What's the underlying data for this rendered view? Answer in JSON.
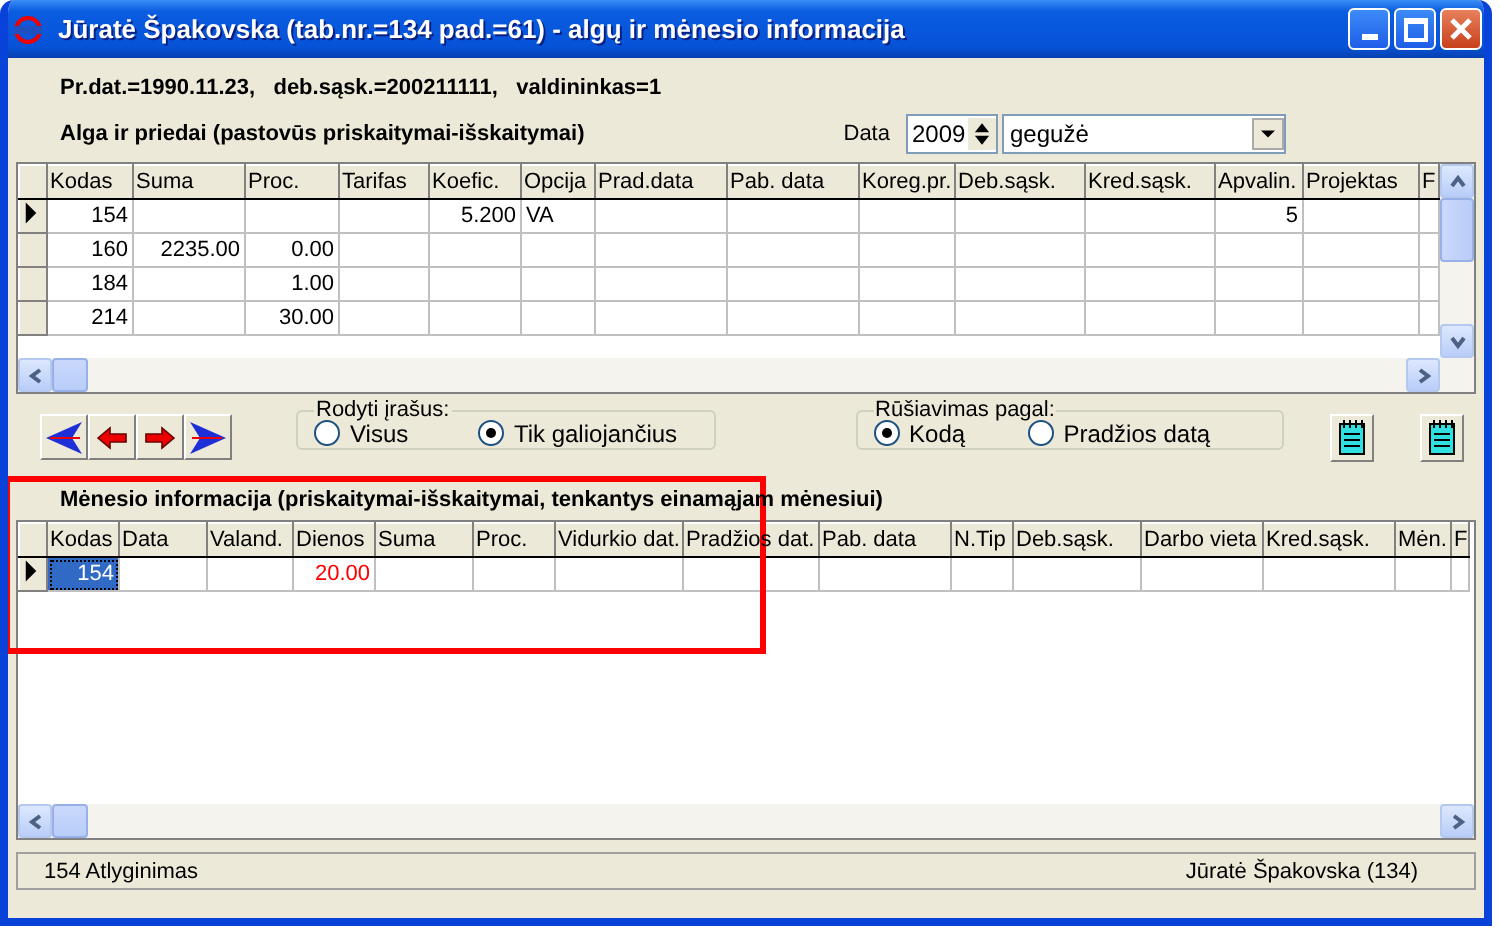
{
  "window": {
    "title": "Jūratė Špakovska (tab.nr.=134 pad.=61) - algų ir mėnesio informacija"
  },
  "info_line": "Pr.dat.=1990.11.23,   deb.sąsk.=200211111,   valdininkas=1",
  "salary_section": {
    "title": "Alga ir priedai (pastovūs priskaitymai-išskaitymai)",
    "date_label": "Data",
    "year": "2009",
    "month": "gegužė",
    "table": {
      "columns": [
        {
          "label": "Kodas",
          "kind": "number"
        },
        {
          "label": "Suma",
          "kind": "number"
        },
        {
          "label": "Proc.",
          "kind": "number"
        },
        {
          "label": "Tarifas",
          "kind": "number"
        },
        {
          "label": "Koefic.",
          "kind": "number"
        },
        {
          "label": "Opcija",
          "kind": "text"
        },
        {
          "label": "Prad.data",
          "kind": "text"
        },
        {
          "label": "Pab. data",
          "kind": "text"
        },
        {
          "label": "Koreg.pr.",
          "kind": "number"
        },
        {
          "label": "Deb.sąsk.",
          "kind": "text"
        },
        {
          "label": "Kred.sąsk.",
          "kind": "text"
        },
        {
          "label": "Apvalin.",
          "kind": "number"
        },
        {
          "label": "Projektas",
          "kind": "text"
        },
        {
          "label": "F",
          "kind": "text"
        }
      ],
      "rows": [
        {
          "selected": true,
          "cells": [
            "154",
            null,
            null,
            null,
            "5.200",
            "VA",
            null,
            null,
            null,
            null,
            null,
            "5",
            null,
            null
          ]
        },
        {
          "selected": false,
          "cells": [
            "160",
            "2235.00",
            "0.00",
            null,
            null,
            null,
            null,
            null,
            null,
            null,
            null,
            null,
            null,
            null
          ]
        },
        {
          "selected": false,
          "cells": [
            "184",
            null,
            "1.00",
            null,
            null,
            null,
            null,
            null,
            null,
            null,
            null,
            null,
            null,
            null
          ]
        },
        {
          "selected": false,
          "cells": [
            "214",
            null,
            "30.00",
            null,
            null,
            null,
            null,
            null,
            null,
            null,
            null,
            null,
            null,
            null
          ]
        }
      ]
    }
  },
  "show_records": {
    "title": "Rodyti įrašus:",
    "options": [
      {
        "label": "Visus",
        "selected": false
      },
      {
        "label": "Tik galiojančius",
        "selected": true
      }
    ]
  },
  "sort_by": {
    "title": "Rūšiavimas pagal:",
    "options": [
      {
        "label": "Kodą",
        "selected": true
      },
      {
        "label": "Pradžios datą",
        "selected": false
      }
    ]
  },
  "monthly_section": {
    "title": "Mėnesio informacija (priskaitymai-išskaitymai, tenkantys einamąjam mėnesiui)",
    "table": {
      "columns": [
        {
          "label": "Kodas",
          "kind": "number"
        },
        {
          "label": "Data",
          "kind": "text"
        },
        {
          "label": "Valand.",
          "kind": "number"
        },
        {
          "label": "Dienos",
          "kind": "number",
          "color": "#ff0000"
        },
        {
          "label": "Suma",
          "kind": "number"
        },
        {
          "label": "Proc.",
          "kind": "number"
        },
        {
          "label": "Vidurkio dat.",
          "kind": "text"
        },
        {
          "label": "Pradžios dat.",
          "kind": "text"
        },
        {
          "label": "Pab. data",
          "kind": "text"
        },
        {
          "label": "N.Tip",
          "kind": "text"
        },
        {
          "label": "Deb.sąsk.",
          "kind": "text"
        },
        {
          "label": "Darbo vieta",
          "kind": "text"
        },
        {
          "label": "Kred.sąsk.",
          "kind": "text"
        },
        {
          "label": "Mėn.",
          "kind": "text"
        },
        {
          "label": "F",
          "kind": "text"
        }
      ],
      "rows": [
        {
          "selected": true,
          "cells": [
            {
              "text": "154",
              "focused": true
            },
            null,
            null,
            {
              "text": "20.00",
              "focused": false
            },
            null,
            null,
            null,
            null,
            null,
            null,
            null,
            null,
            null,
            null,
            null
          ]
        }
      ]
    }
  },
  "status_bar": [
    "154 Atlyginimas",
    "Jūratė Špakovska (134)"
  ]
}
